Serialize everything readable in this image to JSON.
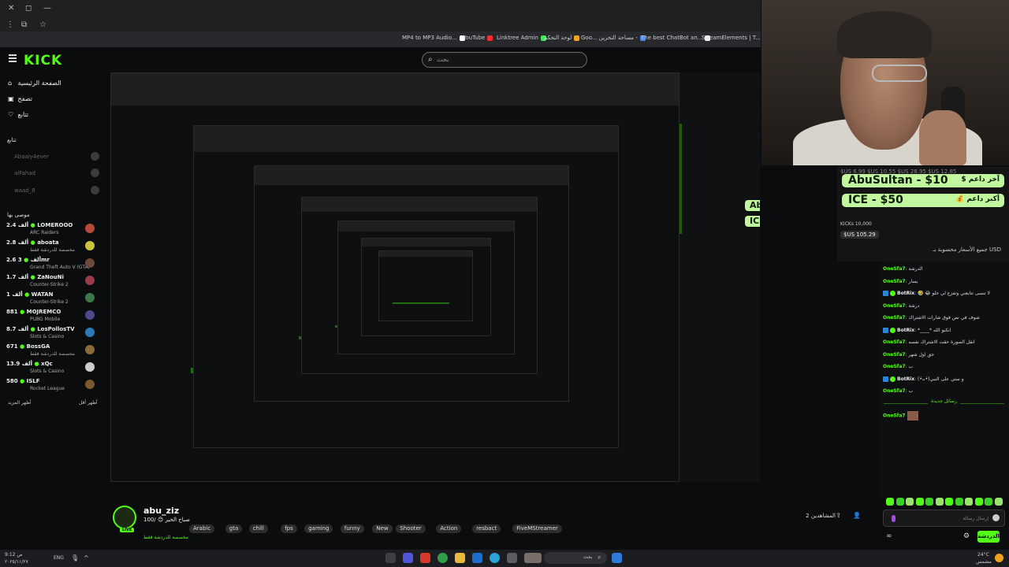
{
  "browser": {
    "bookmarks": [
      {
        "label": "MP4 to MP3 Audio...",
        "color": "#ffffff"
      },
      {
        "label": "YouTube",
        "color": "#ff2b2b"
      },
      {
        "label": "Linktree Admin",
        "color": "#43e660"
      },
      {
        "label": "لوحة التحكم",
        "color": "#f2a12c"
      },
      {
        "label": "Goo... مساحة التخزين -",
        "color": "#4c8bf5"
      },
      {
        "label": "The best ChatBot an...",
        "color": "#ffffff"
      },
      {
        "label": "StreamElements | T...",
        "color": "#6d5bf0"
      }
    ]
  },
  "header": {
    "logo": "KICK",
    "search_placeholder": "بحث"
  },
  "sidebar": {
    "nav": [
      {
        "label": "الصفحة الرئيسية",
        "icon": "home-icon"
      },
      {
        "label": "تصفح",
        "icon": "browse-icon"
      },
      {
        "label": "تتابع",
        "icon": "heart-icon"
      }
    ],
    "following_title": "تتابع",
    "following": [
      "Abaaiy4ever",
      "alFahad",
      "waad_8"
    ],
    "recommended_title": "موصى بها",
    "recommended": [
      {
        "name": "LOMEROOO",
        "viewers": "2.4 ألف",
        "category": "ARC Raiders"
      },
      {
        "name": "aboata",
        "viewers": "2.8 ألف",
        "category": "مخصصة للدردشة فقط"
      },
      {
        "name": "3mr",
        "viewers": "2.6 ألف",
        "category": "Grand Theft Auto V (GTA)"
      },
      {
        "name": "ZaNouNi",
        "viewers": "1.7 ألف",
        "category": "Counter-Strike 2"
      },
      {
        "name": "WATAN",
        "viewers": "1 ألف",
        "category": "Counter-Strike 2"
      },
      {
        "name": "MOJREMCO",
        "viewers": "881",
        "category": "PUBG Mobile"
      },
      {
        "name": "LosPollosTV",
        "viewers": "8.7 ألف",
        "category": "Slots & Casino"
      },
      {
        "name": "BossGA",
        "viewers": "671",
        "category": "مخصصة للدردشة فقط"
      },
      {
        "name": "xQc",
        "viewers": "13.9 ألف",
        "category": "Slots & Casino"
      },
      {
        "name": "ISLF",
        "viewers": "580",
        "category": "Rocket League"
      }
    ],
    "show_more": "أظهر المزيد",
    "show_less": "أظهر أقل"
  },
  "donations": {
    "ticker": "$US 6.99    $US 10.55    $US 28.95    $US 12.85",
    "latest": {
      "value": "AbuSultan - $10",
      "label": "$ آخر داعم"
    },
    "top": {
      "value": "ICE - $50",
      "label": "💰 أكبر داعم"
    },
    "kicks": "KICKs 10,000",
    "total": "$US 105.29",
    "note": "جميع الأسعار محسوبة بـ USD"
  },
  "chat": {
    "messages": [
      {
        "user": "OneSfa7",
        "text": ": الدرشة"
      },
      {
        "user": "OneSfa7",
        "text": ": يسار"
      },
      {
        "user": "BotRix",
        "text": ": 🤣 😂 لا تنسى تتابعني وتفزع لي حلو",
        "bot": true
      },
      {
        "user": "OneSfa7",
        "text": ": درشة"
      },
      {
        "user": "OneSfa7",
        "text": ": شوف في نص فوق شارات الاشتراك"
      },
      {
        "user": "BotRix",
        "text": ": *____* انكبو الله",
        "bot": true
      },
      {
        "user": "OneSfa7",
        "text": ": انقل الصورة حقت الاشتراك نفسه"
      },
      {
        "user": "OneSfa7",
        "text": ": حق اول شهر"
      },
      {
        "user": "OneSfa7",
        "text": ": ب"
      },
      {
        "user": "BotRix",
        "text": ": (•̀ᴗ•́)و ستي على النبي",
        "bot": true
      },
      {
        "user": "OneSfa7",
        "text": ": ب"
      }
    ],
    "new_messages": "رسائل جديدة",
    "last_user": "OneSfa7",
    "input_placeholder": "إرسال رسالة",
    "send_label": "الدردشة"
  },
  "stream": {
    "name": "abu_ziz",
    "title": "صباح الخير 😊 /100",
    "category": "مخصصة للدردشة فقط",
    "live": "LIVE",
    "tags": [
      "Arabic",
      "gta",
      "chill",
      "fps",
      "gaming",
      "funny",
      "New",
      "Shooter",
      "Action",
      "resbact",
      "FiveMStreamer"
    ],
    "followers": "المشاهدين 2"
  },
  "taskbar": {
    "weather": "24°C",
    "weather_sub": "مشمس",
    "lang": "ENG",
    "search": "بحث",
    "time": "9:12 ص",
    "date": "٢٠٢٥/١١/٢٧"
  }
}
